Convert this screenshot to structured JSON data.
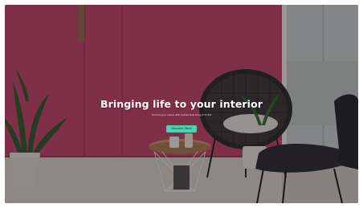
{
  "hero": {
    "title": "Bringing life to your interior",
    "subtitle": "Furnish your space with pieces that bring it to life",
    "cta_label": "Discover More"
  },
  "colors": {
    "wall_pink": "#c2446b",
    "cta_accent": "#4fd1b2",
    "floor": "#d9d2cf"
  }
}
